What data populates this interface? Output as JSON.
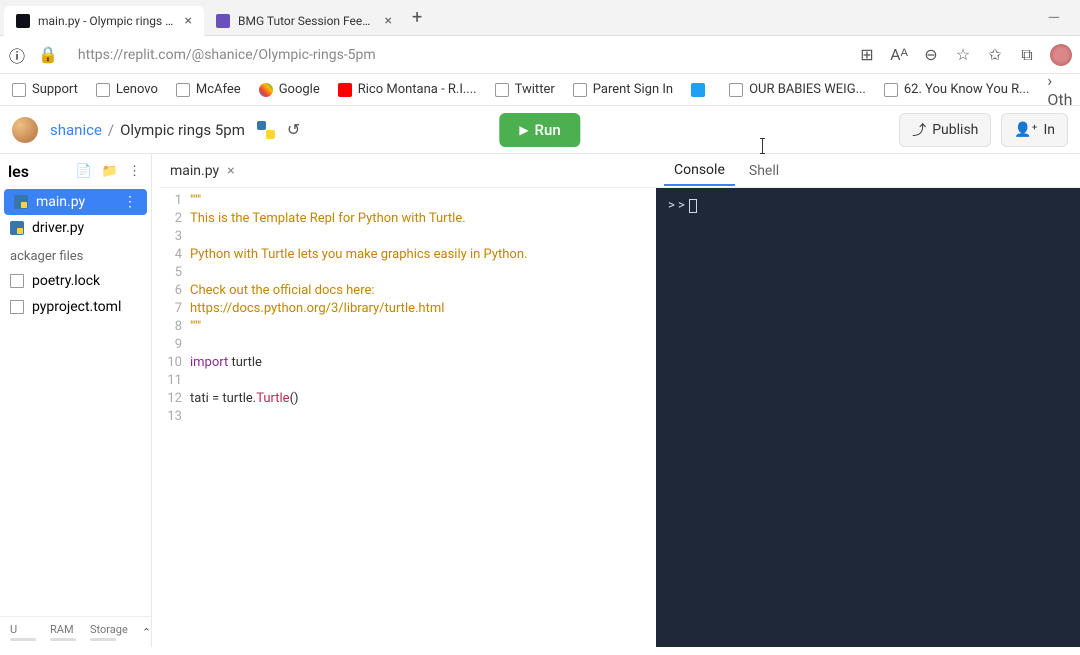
{
  "browser": {
    "tabs": [
      {
        "title": "main.py - Olympic rings 5pm - R",
        "active": true
      },
      {
        "title": "BMG Tutor Session Feedback Fo",
        "active": false
      }
    ],
    "url": "https://replit.com/@shanice/Olympic-rings-5pm"
  },
  "bookmarks": [
    {
      "label": "Support",
      "icon": "page"
    },
    {
      "label": "Lenovo",
      "icon": "page"
    },
    {
      "label": "McAfee",
      "icon": "page"
    },
    {
      "label": "Google",
      "icon": "g"
    },
    {
      "label": "Rico Montana - R.I....",
      "icon": "yt"
    },
    {
      "label": "Twitter",
      "icon": "page"
    },
    {
      "label": "Parent Sign In",
      "icon": "page"
    },
    {
      "label": "",
      "icon": "tw"
    },
    {
      "label": "OUR BABIES WEIG...",
      "icon": "page"
    },
    {
      "label": "62. You Know You R...",
      "icon": "page"
    }
  ],
  "bookmarks_overflow": "Oth",
  "header": {
    "user": "shanice",
    "project": "Olympic rings 5pm",
    "run": "Run",
    "publish": "Publish",
    "invite": "In"
  },
  "sidebar": {
    "title": "les",
    "files": [
      {
        "name": "main.py",
        "icon": "py",
        "active": true
      },
      {
        "name": "driver.py",
        "icon": "py",
        "active": false
      }
    ],
    "section": "ackager files",
    "packager": [
      {
        "name": "poetry.lock",
        "icon": "doc"
      },
      {
        "name": "pyproject.toml",
        "icon": "doc"
      }
    ],
    "stats": [
      "U",
      "RAM",
      "Storage"
    ]
  },
  "editor": {
    "tab": "main.py",
    "lines": [
      {
        "n": 1,
        "html": "<span class='tok-str'>\"\"\"</span>"
      },
      {
        "n": 2,
        "html": "<span class='tok-str'>This is the Template Repl for Python with Turtle.</span>"
      },
      {
        "n": 3,
        "html": ""
      },
      {
        "n": 4,
        "html": "<span class='tok-str'>Python with Turtle lets you make graphics easily in Python.</span>"
      },
      {
        "n": 5,
        "html": ""
      },
      {
        "n": 6,
        "html": "<span class='tok-str'>Check out the official docs here:</span>"
      },
      {
        "n": "",
        "html": "<span class='tok-str'>https://docs.python.org/3/library/turtle.html</span>"
      },
      {
        "n": 7,
        "html": "<span class='tok-str'>\"\"\"</span>"
      },
      {
        "n": 8,
        "html": ""
      },
      {
        "n": 9,
        "html": "<span class='tok-kw'>import</span> turtle"
      },
      {
        "n": 10,
        "html": ""
      },
      {
        "n": 11,
        "html": "tati = turtle.<span class='tok-cls'>Turtle</span>()"
      },
      {
        "n": 12,
        "html": ""
      },
      {
        "n": 13,
        "html": ""
      }
    ]
  },
  "console": {
    "tabs": [
      "Console",
      "Shell"
    ],
    "active_tab": 0,
    "prompt": "> >"
  }
}
